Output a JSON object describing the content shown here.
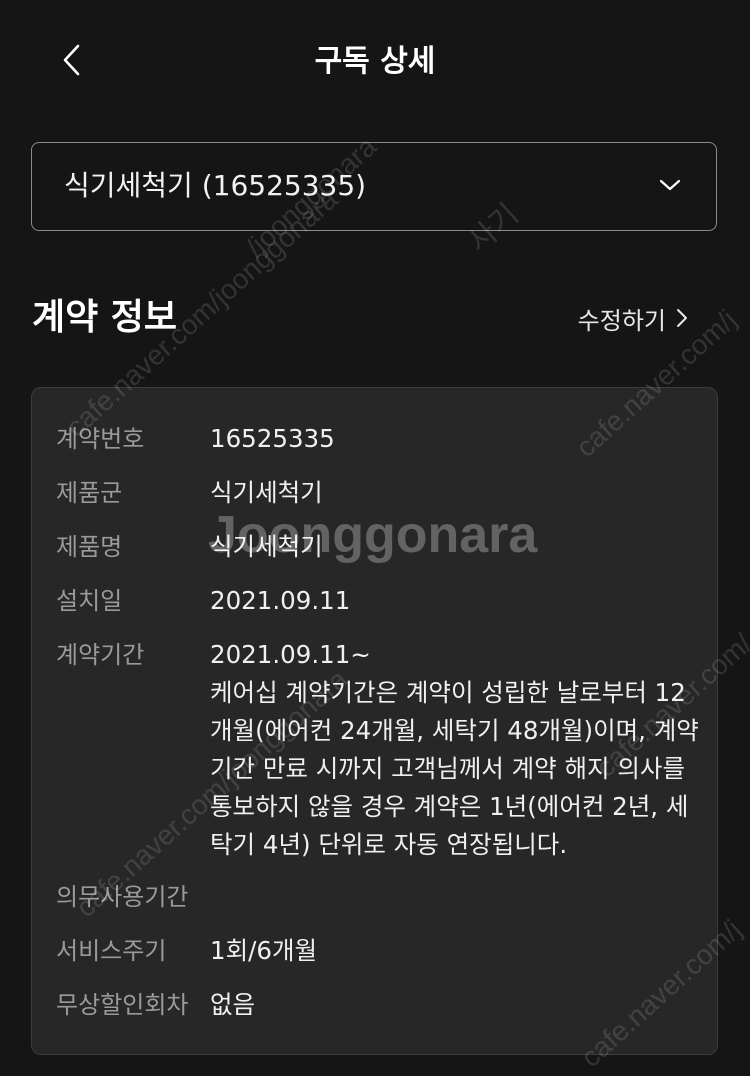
{
  "header": {
    "title": "구독 상세"
  },
  "product_select": {
    "value": "식기세척기 (16525335)"
  },
  "section": {
    "title": "계약 정보",
    "edit_label": "수정하기"
  },
  "contract": {
    "rows": [
      {
        "label": "계약번호",
        "value": "16525335"
      },
      {
        "label": "제품군",
        "value": "식기세척기"
      },
      {
        "label": "제품명",
        "value": "식기세척기"
      },
      {
        "label": "설치일",
        "value": "2021.09.11"
      },
      {
        "label": "계약기간",
        "value_lines": [
          "2021.09.11~",
          "케어십 계약기간은 계약이 성립한 날로부터 12",
          "개월(에어컨 24개월, 세탁기 48개월)이며, 계약",
          "기간 만료 시까지 고객님께서 계약 해지 의사를",
          "통보하지 않을 경우 계약은 1년(에어컨 2년, 세",
          "탁기 4년) 단위로 자동 연장됩니다."
        ]
      },
      {
        "label": "의무사용기간",
        "value": ""
      },
      {
        "label": "서비스주기",
        "value": "1회/6개월"
      },
      {
        "label": "무상할인회차",
        "value": "없음"
      }
    ]
  },
  "watermarks": {
    "main": "Joonggonara",
    "url": "cafe.naver.com/joonggonara",
    "url_short": "cafe.naver.com/j",
    "url_mid": "cafe.naver.com/",
    "url_side": "/joonggonara",
    "tag": "사기"
  },
  "icons": {
    "back": "chevron-left-icon",
    "dropdown": "chevron-down-icon",
    "edit_arrow": "chevron-right-icon"
  },
  "colors": {
    "background": "#151515",
    "card": "#272727",
    "label": "#9a9a9a",
    "text": "#f0f0f0"
  }
}
